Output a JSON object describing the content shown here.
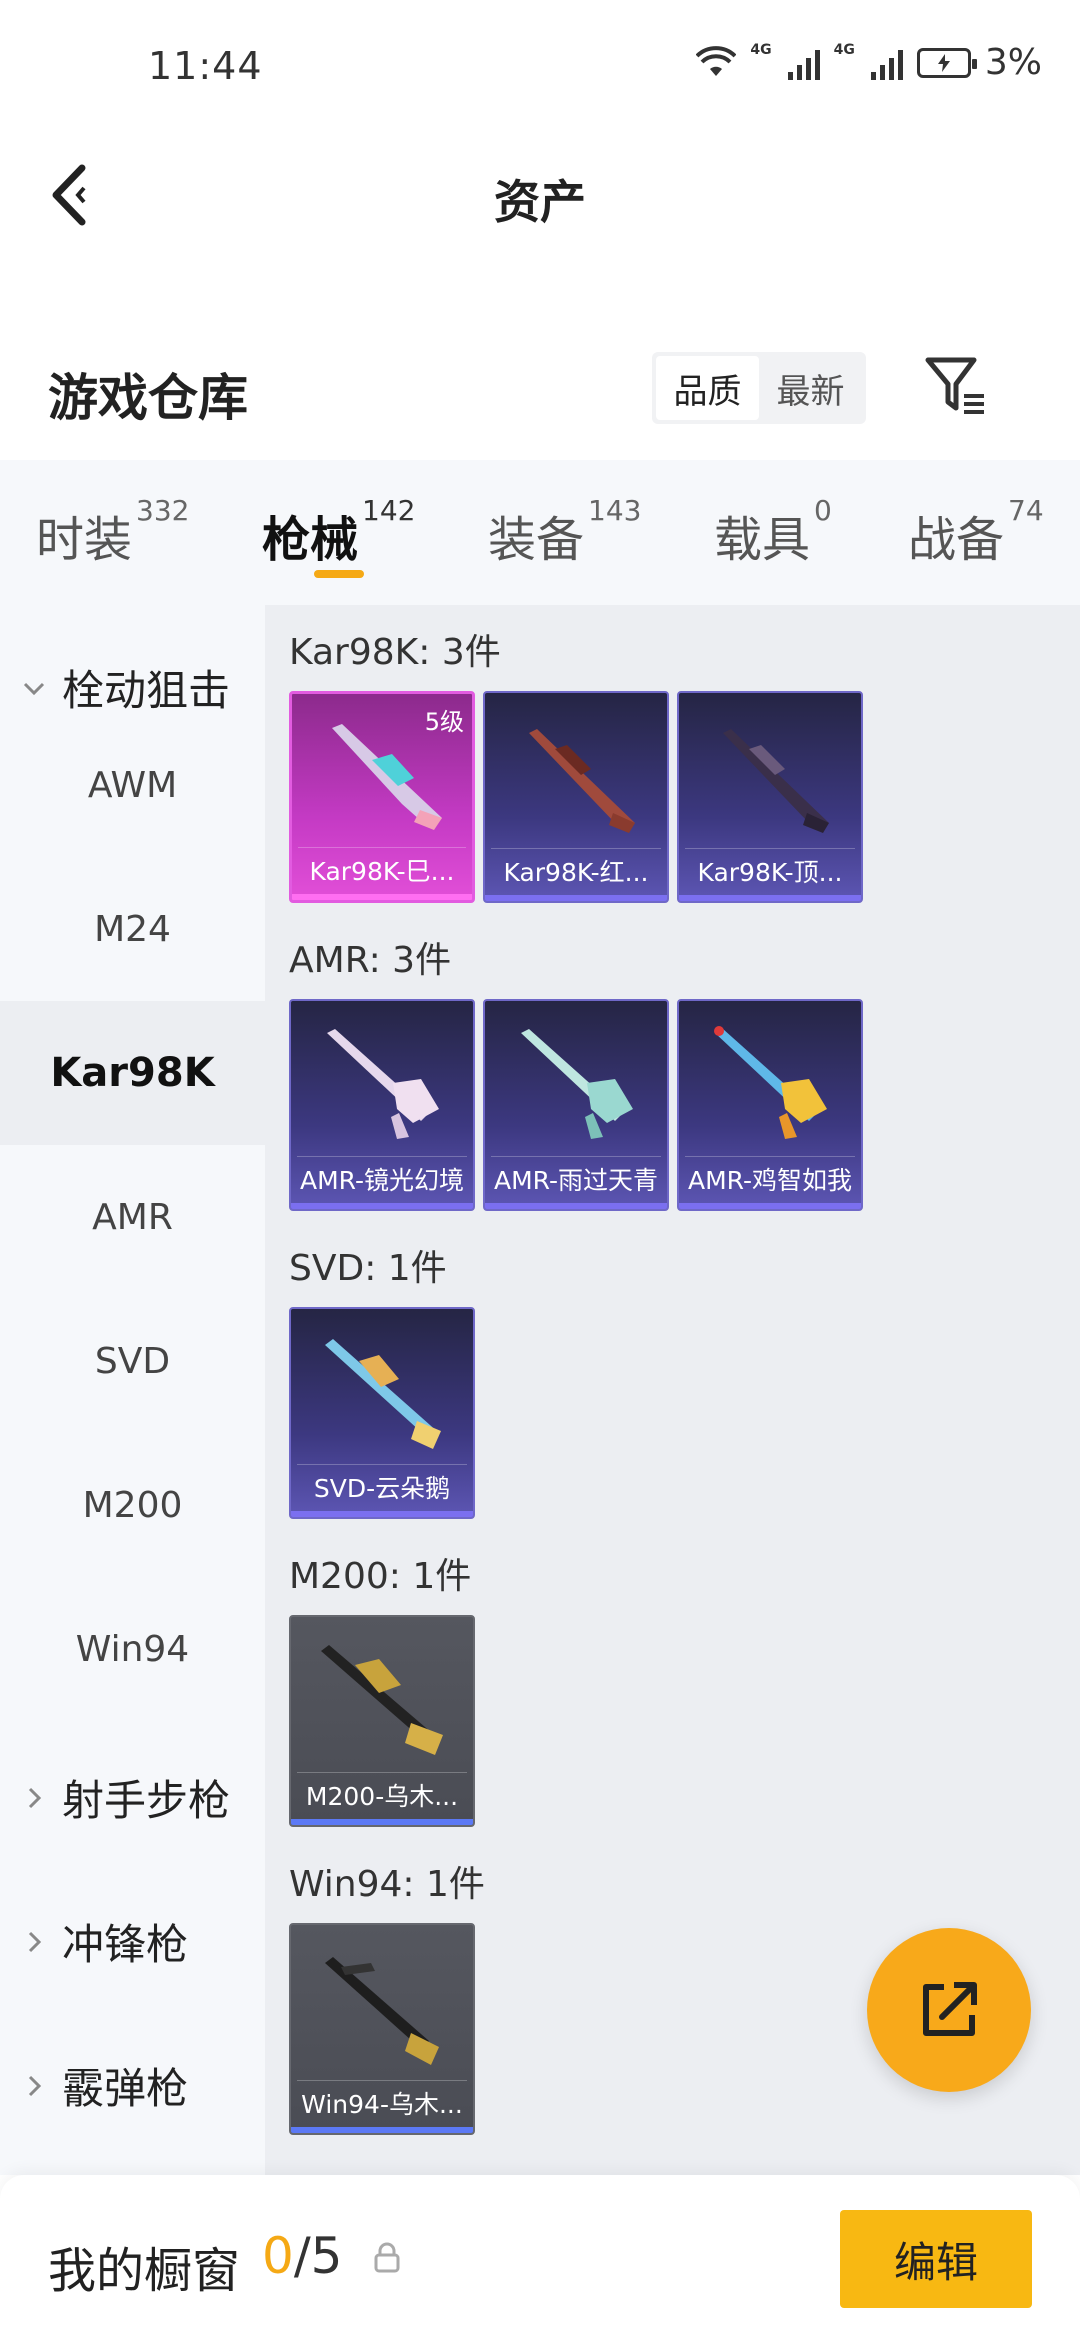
{
  "status_bar": {
    "time": "11:44",
    "network1": "4G",
    "network2": "4G",
    "battery": "3%"
  },
  "header": {
    "title": "资产"
  },
  "warehouse": {
    "title": "游戏仓库",
    "sort_options": [
      "品质",
      "最新"
    ],
    "active_sort": "品质"
  },
  "tabs": [
    {
      "label": "时装",
      "count": "332"
    },
    {
      "label": "枪械",
      "count": "142"
    },
    {
      "label": "装备",
      "count": "143"
    },
    {
      "label": "载具",
      "count": "0"
    },
    {
      "label": "战备",
      "count": "74"
    }
  ],
  "active_tab": "枪械",
  "sidebar": {
    "groups": [
      {
        "label": "栓动狙击",
        "expanded": true
      },
      {
        "label": "射手步枪",
        "expanded": false
      },
      {
        "label": "冲锋枪",
        "expanded": false
      },
      {
        "label": "霰弹枪",
        "expanded": false
      }
    ],
    "items": [
      "AWM",
      "M24",
      "Kar98K",
      "AMR",
      "SVD",
      "M200",
      "Win94"
    ],
    "active_item": "Kar98K"
  },
  "sections": [
    {
      "title": "Kar98K: 3件",
      "cards": [
        {
          "name": "Kar98K-巳...",
          "level": "5级",
          "rarity": "pink"
        },
        {
          "name": "Kar98K-红...",
          "rarity": "purple"
        },
        {
          "name": "Kar98K-顶...",
          "rarity": "purple"
        }
      ]
    },
    {
      "title": "AMR: 3件",
      "cards": [
        {
          "name": "AMR-镜光幻境",
          "rarity": "purple"
        },
        {
          "name": "AMR-雨过天青",
          "rarity": "purple"
        },
        {
          "name": "AMR-鸡智如我",
          "rarity": "purple"
        }
      ]
    },
    {
      "title": "SVD: 1件",
      "cards": [
        {
          "name": "SVD-云朵鹅",
          "rarity": "purple"
        }
      ]
    },
    {
      "title": "M200: 1件",
      "cards": [
        {
          "name": "M200-乌木...",
          "rarity": "gray"
        }
      ]
    },
    {
      "title": "Win94: 1件",
      "cards": [
        {
          "name": "Win94-乌木...",
          "rarity": "gray"
        }
      ]
    }
  ],
  "bottom_bar": {
    "label": "我的橱窗",
    "current": "0",
    "separator": "/",
    "max": "5",
    "edit_label": "编辑"
  },
  "colors": {
    "accent": "#f5a915",
    "fab": "#f8a91a",
    "edit_button": "#f8b812",
    "rarity_pink": "#e25be0",
    "rarity_purple": "#6f68c8",
    "rarity_gray": "#66686f"
  },
  "icons": {
    "back": "back-icon",
    "filter": "filter-icon",
    "share": "share-icon",
    "lock": "lock-icon",
    "chevron": "chevron-icon",
    "wifi": "wifi-icon"
  }
}
